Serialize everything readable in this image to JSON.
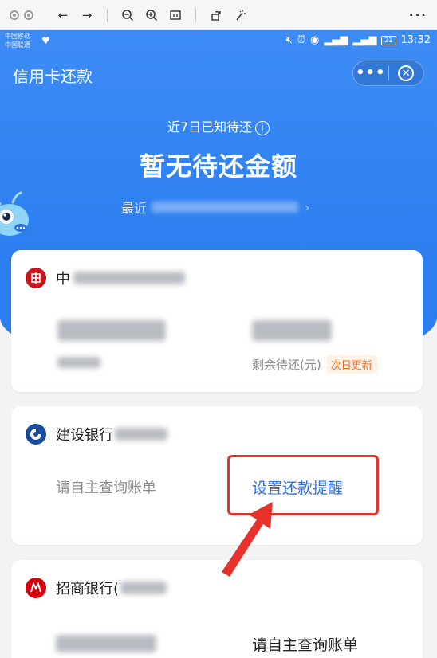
{
  "viewer": {
    "icons": [
      "back-arrow-icon",
      "forward-arrow-icon",
      "zoom-out-icon",
      "zoom-in-icon",
      "fit-icon",
      "rotate-icon",
      "magic-icon"
    ],
    "more_label": "···"
  },
  "status_bar": {
    "carrier_1": "中国移动",
    "carrier_2": "中国联通",
    "time": "13:32",
    "battery": "21"
  },
  "nav": {
    "title": "信用卡还款",
    "more_label": "•••",
    "close_label": "✕"
  },
  "summary": {
    "label": "近7日已知待还",
    "info_icon": "i",
    "amount_text": "暂无待还金额",
    "recent_label": "最近"
  },
  "cards": [
    {
      "bank_name": "中",
      "remaining_label": "剩余待还(元)",
      "next_day_tag": "次日更新"
    },
    {
      "bank_name": "建设银行",
      "query_text": "请自主查询账单",
      "remind_text": "设置还款提醒"
    },
    {
      "bank_name": "招商银行(",
      "query_text": "请自主查询账单"
    }
  ],
  "colors": {
    "brand_blue": "#2e7ff0",
    "link_blue": "#2a6ef0",
    "annotation_red": "#e6322b",
    "tag_orange": "#f26b1d"
  }
}
